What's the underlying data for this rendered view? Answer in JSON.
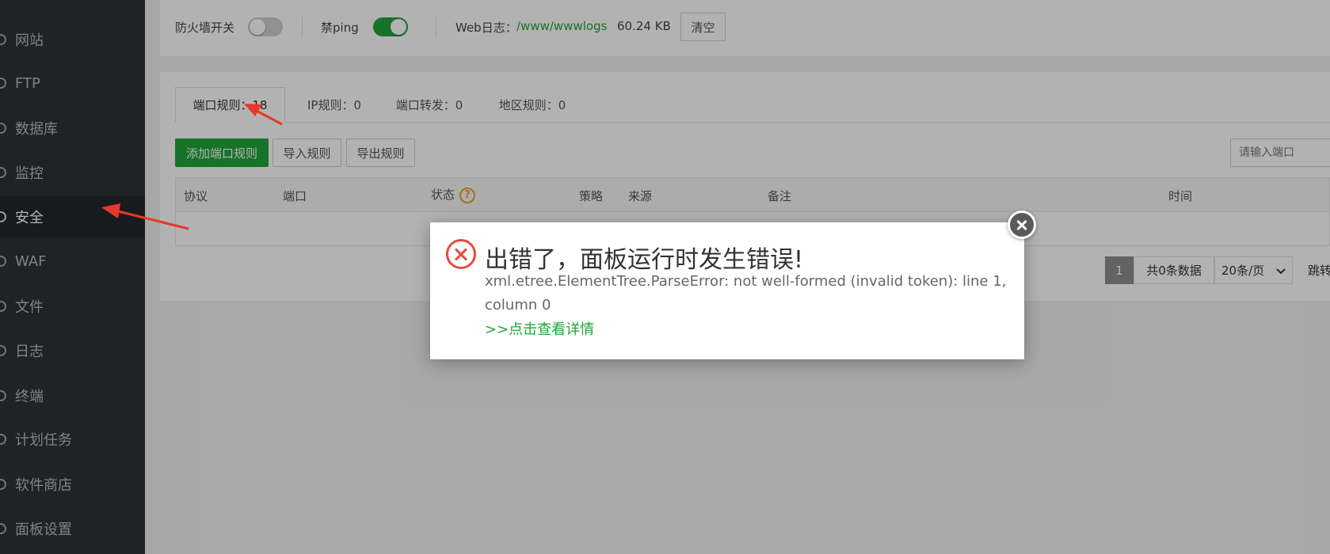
{
  "sidebar": {
    "items": [
      {
        "label": "网站",
        "icon": "globe-icon",
        "active": false
      },
      {
        "label": "FTP",
        "icon": "ftp-icon",
        "active": false
      },
      {
        "label": "数据库",
        "icon": "database-icon",
        "active": false
      },
      {
        "label": "监控",
        "icon": "monitor-icon",
        "active": false
      },
      {
        "label": "安全",
        "icon": "shield-icon",
        "active": true
      },
      {
        "label": "WAF",
        "icon": "waf-shield-icon",
        "active": false
      },
      {
        "label": "文件",
        "icon": "folder-icon",
        "active": false
      },
      {
        "label": "日志",
        "icon": "log-icon",
        "active": false
      },
      {
        "label": "终端",
        "icon": "terminal-icon",
        "active": false
      },
      {
        "label": "计划任务",
        "icon": "cron-icon",
        "active": false
      },
      {
        "label": "软件商店",
        "icon": "store-icon",
        "active": false
      },
      {
        "label": "面板设置",
        "icon": "settings-icon",
        "active": false
      }
    ]
  },
  "topbar": {
    "firewall_label": "防火墙开关",
    "firewall_on": false,
    "ping_label": "禁ping",
    "ping_on": true,
    "weblog_label": "Web日志：",
    "weblog_path": "/www/wwwlogs",
    "weblog_size": "60.24 KB",
    "clear_label": "清空"
  },
  "tabs": [
    {
      "label": "端口规则：18",
      "active": true
    },
    {
      "label": "IP规则：0",
      "active": false
    },
    {
      "label": "端口转发：0",
      "active": false
    },
    {
      "label": "地区规则：0",
      "active": false
    }
  ],
  "toolbar": {
    "add_label": "添加端口规则",
    "import_label": "导入规则",
    "export_label": "导出规则",
    "search_placeholder": "请输入端口"
  },
  "table": {
    "headers": [
      "协议",
      "端口",
      "状态",
      "策略",
      "来源",
      "备注",
      "时间"
    ]
  },
  "pagination": {
    "current_page": "1",
    "total": "共0条数据",
    "per_page": "20条/页",
    "jump": "跳转"
  },
  "dialog": {
    "title": "出错了，面板运行时发生错误!",
    "message": "xml.etree.ElementTree.ParseError: not well-formed (invalid token): line 1, column 0",
    "link": ">>点击查看详情"
  },
  "colors": {
    "accent": "#20a53a",
    "error": "#e64b3c",
    "annotation_arrow": "#e8372b"
  }
}
